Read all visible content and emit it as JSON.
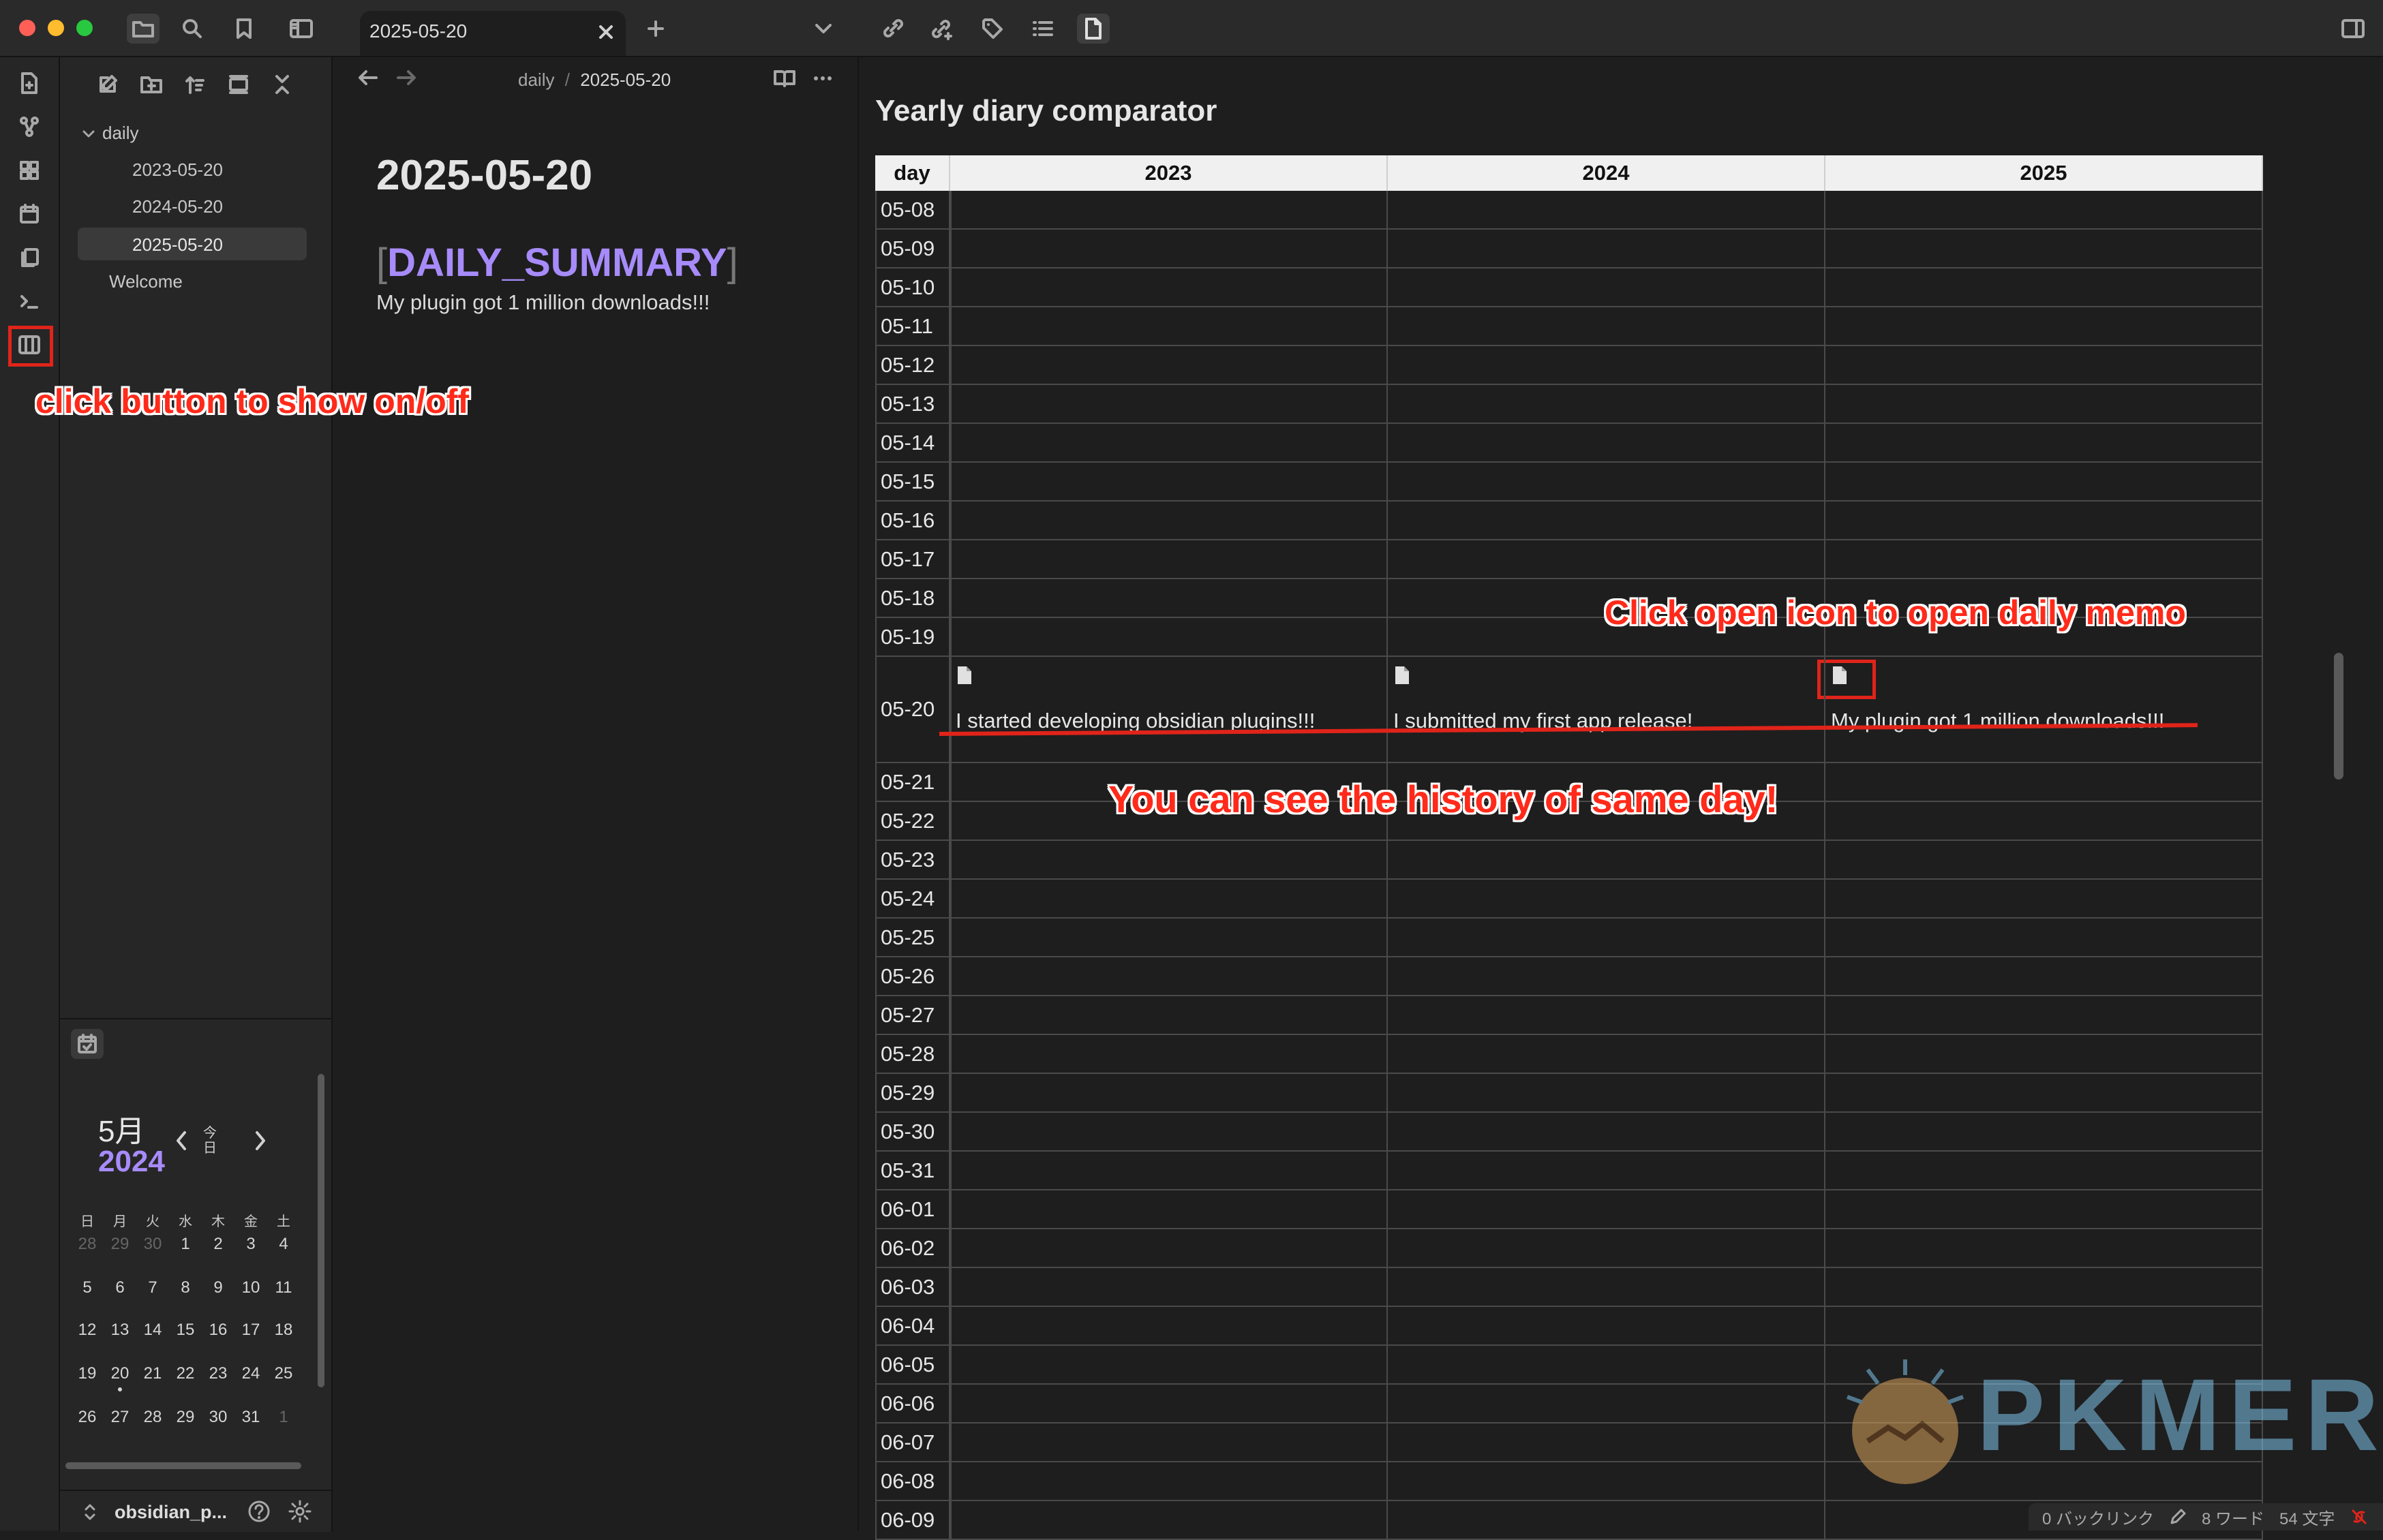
{
  "app": {
    "accent": "#a78bfa",
    "annotation_color": "#ff2a1a"
  },
  "titlebar": {
    "active_tab": "2025-05-20",
    "toolbar_icons": [
      "folder-icon",
      "search-icon",
      "bookmark-icon",
      "sidebar-toggle-icon"
    ],
    "plugin_icons": [
      "link-icon",
      "link-plus-icon",
      "tag-icon",
      "list-icon",
      "file-icon"
    ]
  },
  "ribbon": {
    "icons": [
      "new-note-icon",
      "graph-icon",
      "dashboard-icon",
      "calendar-icon",
      "copy-icon",
      "terminal-icon",
      "comparator-icon"
    ]
  },
  "explorer": {
    "folder": "daily",
    "files": [
      "2023-05-20",
      "2024-05-20",
      "2025-05-20"
    ],
    "selected": "2025-05-20",
    "extra_file": "Welcome"
  },
  "calendar": {
    "month": "5月",
    "year": "2024",
    "today_label": "今日",
    "weekdays": [
      "日",
      "月",
      "火",
      "水",
      "木",
      "金",
      "土"
    ],
    "weeks": [
      [
        {
          "d": "28",
          "dim": true
        },
        {
          "d": "29",
          "dim": true
        },
        {
          "d": "30",
          "dim": true
        },
        {
          "d": "1"
        },
        {
          "d": "2"
        },
        {
          "d": "3"
        },
        {
          "d": "4"
        }
      ],
      [
        {
          "d": "5"
        },
        {
          "d": "6"
        },
        {
          "d": "7"
        },
        {
          "d": "8"
        },
        {
          "d": "9"
        },
        {
          "d": "10"
        },
        {
          "d": "11"
        }
      ],
      [
        {
          "d": "12"
        },
        {
          "d": "13"
        },
        {
          "d": "14"
        },
        {
          "d": "15"
        },
        {
          "d": "16"
        },
        {
          "d": "17"
        },
        {
          "d": "18"
        }
      ],
      [
        {
          "d": "19"
        },
        {
          "d": "20",
          "dot": true
        },
        {
          "d": "21"
        },
        {
          "d": "22"
        },
        {
          "d": "23"
        },
        {
          "d": "24"
        },
        {
          "d": "25"
        }
      ],
      [
        {
          "d": "26"
        },
        {
          "d": "27"
        },
        {
          "d": "28"
        },
        {
          "d": "29"
        },
        {
          "d": "30"
        },
        {
          "d": "31"
        },
        {
          "d": "1",
          "dim": true
        }
      ]
    ]
  },
  "vault": {
    "name": "obsidian_p..."
  },
  "editor": {
    "breadcrumb_folder": "daily",
    "breadcrumb_sep": "/",
    "breadcrumb_file": "2025-05-20",
    "heading": "2025-05-20",
    "summary_open": "[",
    "summary_label": "DAILY_SUMMARY",
    "summary_close": "]",
    "body": "My plugin got 1 million downloads!!!"
  },
  "comparator": {
    "title": "Yearly diary comparator",
    "day_header": "day",
    "years": [
      "2023",
      "2024",
      "2025"
    ],
    "days_before": [
      "05-08",
      "05-09",
      "05-10",
      "05-11",
      "05-12",
      "05-13",
      "05-14",
      "05-15",
      "05-16",
      "05-17",
      "05-18",
      "05-19"
    ],
    "highlight_day": "05-20",
    "memos": [
      "I started developing obsidian plugins!!!",
      "I submitted my first app release!",
      "My plugin got 1 million downloads!!!"
    ],
    "days_after": [
      "05-21",
      "05-22",
      "05-23",
      "05-24",
      "05-25",
      "05-26",
      "05-27",
      "05-28",
      "05-29",
      "05-30",
      "05-31",
      "06-01",
      "06-02",
      "06-03",
      "06-04",
      "06-05",
      "06-06",
      "06-07",
      "06-08",
      "06-09"
    ]
  },
  "annotations": {
    "toggle_hint": "click button to show on/off",
    "open_hint": "Click open icon to open daily memo",
    "history_hint": "You can see the history of same day!"
  },
  "statusbar": {
    "backlinks": "0 バックリンク",
    "words": "8 ワード",
    "chars": "54 文字"
  },
  "watermark": {
    "text": "PKMER"
  }
}
